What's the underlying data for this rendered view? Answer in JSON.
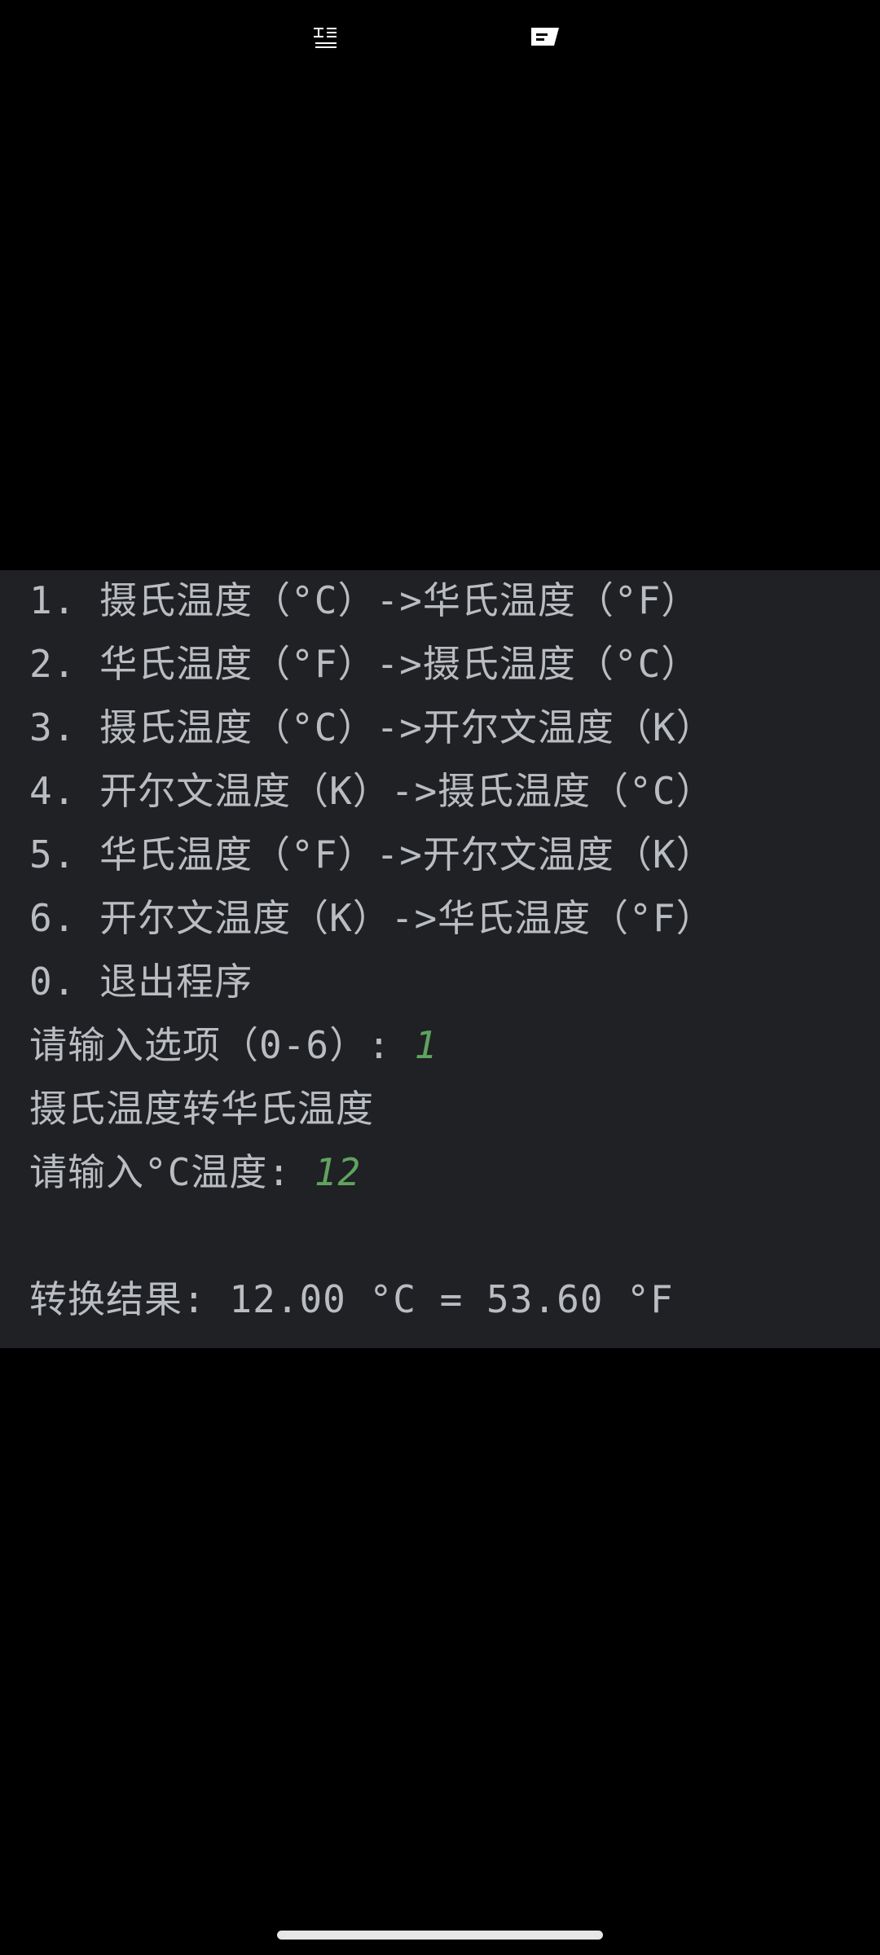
{
  "status_bar": {
    "left_icon": "signal-status-icon",
    "right_icon": "message-notification-icon"
  },
  "terminal": {
    "menu": [
      {
        "number": "1.",
        "text": "摄氏温度（°C）->华氏温度（°F）"
      },
      {
        "number": "2.",
        "text": "华氏温度（°F）->摄氏温度（°C）"
      },
      {
        "number": "3.",
        "text": "摄氏温度（°C）->开尔文温度（K）"
      },
      {
        "number": "4.",
        "text": "开尔文温度（K）->摄氏温度（°C）"
      },
      {
        "number": "5.",
        "text": "华氏温度（°F）->开尔文温度（K）"
      },
      {
        "number": "6.",
        "text": "开尔文温度（K）->华氏温度（°F）"
      },
      {
        "number": "0.",
        "text": "退出程序"
      }
    ],
    "option_prompt": "请输入选项（0-6）: ",
    "option_value": "1",
    "mode_label": "摄氏温度转华氏温度",
    "temp_prompt": "请输入°C温度: ",
    "temp_value": "12",
    "result_text": "转换结果: 12.00 °C = 53.60 °F"
  },
  "colors": {
    "terminal_bg": "#202124",
    "text": "#b9bcc1",
    "input": "#5fa35f"
  }
}
